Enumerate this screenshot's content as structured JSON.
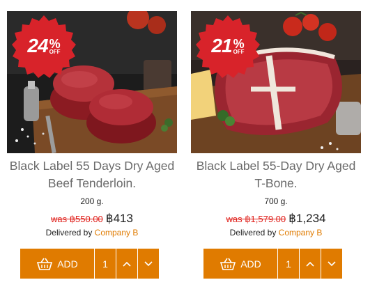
{
  "products": [
    {
      "discount_number": "24",
      "discount_percent": "%",
      "discount_off": "OFF",
      "title": "Black Label 55 Days Dry Aged Beef Tenderloin.",
      "weight": "200 g.",
      "was_price": "was ฿550.00",
      "price": "฿413",
      "delivered_prefix": "Delivered by",
      "company": "Company B",
      "add_label": "ADD",
      "quantity": "1"
    },
    {
      "discount_number": "21",
      "discount_percent": "%",
      "discount_off": "OFF",
      "title": "Black Label 55-Day Dry Aged T-Bone.",
      "weight": "700 g.",
      "was_price": "was ฿1,579.00",
      "price": "฿1,234",
      "delivered_prefix": "Delivered by",
      "company": "Company B",
      "add_label": "ADD",
      "quantity": "1"
    }
  ],
  "colors": {
    "accent": "#e07b00",
    "badge": "#d8232a",
    "strike": "#e0211c",
    "title": "#6a6a6a"
  },
  "icons": [
    "basket-icon",
    "chevron-up-icon",
    "chevron-down-icon"
  ]
}
